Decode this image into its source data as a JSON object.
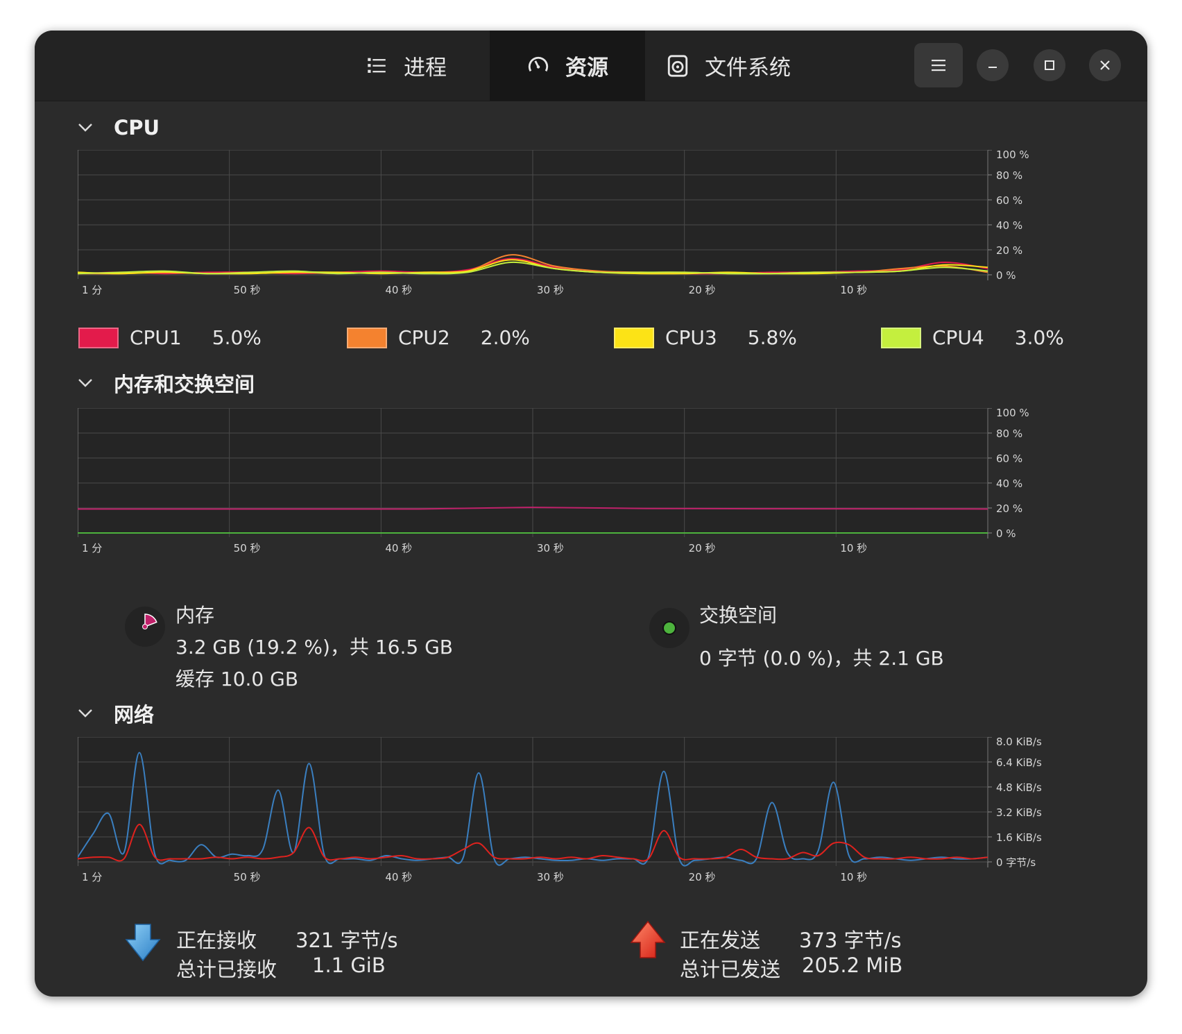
{
  "header": {
    "tabs": [
      {
        "label": "进程",
        "icon": "list-icon"
      },
      {
        "label": "资源",
        "icon": "gauge-icon",
        "active": true
      },
      {
        "label": "文件系统",
        "icon": "disk-icon"
      }
    ],
    "menu_icon": "hamburger-menu-icon",
    "window_controls": [
      "minimize-icon",
      "maximize-icon",
      "close-icon"
    ]
  },
  "time_axis": [
    "1 分",
    "50 秒",
    "40 秒",
    "30 秒",
    "20 秒",
    "10 秒"
  ],
  "cpu": {
    "title": "CPU",
    "y_ticks": [
      "100 %",
      "80 %",
      "60 %",
      "40 %",
      "20 %",
      "0 %"
    ],
    "legend": [
      {
        "name": "CPU1",
        "value": "5.0%",
        "color": "#e31b4b"
      },
      {
        "name": "CPU2",
        "value": "2.0%",
        "color": "#f4822f"
      },
      {
        "name": "CPU3",
        "value": "5.8%",
        "color": "#fce316"
      },
      {
        "name": "CPU4",
        "value": "3.0%",
        "color": "#c4ef3e"
      }
    ]
  },
  "memory": {
    "title": "内存和交换空间",
    "y_ticks": [
      "100 %",
      "80 %",
      "60 %",
      "40 %",
      "20 %",
      "0 %"
    ],
    "mem_label": "内存",
    "mem_usage": "3.2 GB (19.2 %)，共 16.5 GB",
    "mem_cache": "缓存 10.0 GB",
    "mem_fraction": 0.192,
    "swap_label": "交换空间",
    "swap_usage": "0 字节 (0.0 %)，共 2.1 GB",
    "colors": {
      "memory": "#c0216a",
      "swap": "#4db33d"
    }
  },
  "network": {
    "title": "网络",
    "y_ticks": [
      "8.0 KiB/s",
      "6.4 KiB/s",
      "4.8 KiB/s",
      "3.2 KiB/s",
      "1.6 KiB/s",
      "0 字节/s"
    ],
    "receiving_label": "正在接收",
    "receiving_value": "321 字节/s",
    "total_received_label": "总计已接收",
    "total_received_value": "1.1 GiB",
    "sending_label": "正在发送",
    "sending_value": "373 字节/s",
    "total_sent_label": "总计已发送",
    "total_sent_value": "205.2 MiB",
    "colors": {
      "receiving": "#3a7fc0",
      "sending": "#e0221e"
    }
  },
  "chart_data": [
    {
      "type": "line",
      "x": [
        60,
        57,
        54,
        51,
        48,
        45,
        42,
        39,
        36,
        33,
        30,
        27,
        24,
        21,
        18,
        15,
        12,
        9,
        6,
        3,
        0
      ],
      "ylim": [
        0,
        100
      ],
      "series": [
        {
          "name": "CPU1",
          "values": [
            1,
            2,
            1,
            2,
            2,
            1,
            2,
            3,
            2,
            4,
            13,
            6,
            2,
            2,
            1,
            1,
            2,
            2,
            3,
            4,
            10,
            5
          ]
        },
        {
          "name": "CPU2",
          "values": [
            1,
            1,
            2,
            1,
            2,
            2,
            1,
            2,
            1,
            3,
            16,
            7,
            3,
            2,
            2,
            1,
            1,
            2,
            2,
            5,
            7,
            2
          ]
        },
        {
          "name": "CPU3",
          "values": [
            2,
            1,
            2,
            1,
            1,
            2,
            2,
            1,
            2,
            3,
            12,
            5,
            2,
            1,
            1,
            2,
            1,
            1,
            2,
            3,
            8,
            6
          ]
        },
        {
          "name": "CPU4",
          "values": [
            1,
            2,
            3,
            1,
            2,
            3,
            1,
            2,
            1,
            2,
            10,
            5,
            2,
            2,
            2,
            1,
            1,
            2,
            2,
            3,
            6,
            3
          ]
        }
      ]
    },
    {
      "type": "line",
      "x": [
        60,
        45,
        40,
        35,
        32,
        28,
        20,
        10,
        0
      ],
      "ylim": [
        0,
        100
      ],
      "series": [
        {
          "name": "内存",
          "values": [
            19.2,
            19.2,
            19.2,
            19.2,
            20.5,
            19.6,
            19.4,
            19.3,
            19.2
          ]
        },
        {
          "name": "交换空间",
          "values": [
            0,
            0,
            0,
            0,
            0,
            0,
            0,
            0,
            0
          ]
        }
      ]
    },
    {
      "type": "line",
      "x": [
        60,
        58,
        57,
        56,
        55,
        54,
        53,
        52,
        51,
        50,
        49,
        48,
        47,
        46,
        45,
        44,
        43,
        42,
        41,
        40,
        39,
        38,
        37,
        36,
        35,
        34,
        33,
        32,
        31,
        30,
        29,
        28,
        27,
        26,
        25,
        24,
        23,
        22,
        21,
        20,
        19,
        18,
        17,
        16,
        15,
        14,
        13,
        12,
        11,
        10,
        9,
        8,
        7,
        6,
        5,
        4,
        3,
        2,
        1,
        0
      ],
      "ylim": [
        0,
        8.0
      ],
      "series": [
        {
          "name": "正在接收",
          "values": [
            0.3,
            1.8,
            3.1,
            0.6,
            7.0,
            0.5,
            0.1,
            0.1,
            1.1,
            0.3,
            0.5,
            0.4,
            0.8,
            4.6,
            0.6,
            6.3,
            0.4,
            0.2,
            0.2,
            0.1,
            0.4,
            0.2,
            0.1,
            0.2,
            0.3,
            0.3,
            5.7,
            0.2,
            0.2,
            0.3,
            0.2,
            0.1,
            0.1,
            0.2,
            0.1,
            0.2,
            0.2,
            0.3,
            5.8,
            0.2,
            0.1,
            0.2,
            0.3,
            0.1,
            0.2,
            3.8,
            0.6,
            0.2,
            0.7,
            5.1,
            0.4,
            0.2,
            0.3,
            0.2,
            0.1,
            0.2,
            0.3,
            0.2,
            0.2,
            0.3
          ]
        },
        {
          "name": "正在发送",
          "values": [
            0.2,
            0.3,
            0.3,
            0.2,
            2.4,
            0.3,
            0.2,
            0.2,
            0.2,
            0.3,
            0.2,
            0.3,
            0.2,
            0.3,
            0.6,
            2.2,
            0.3,
            0.2,
            0.3,
            0.2,
            0.3,
            0.4,
            0.2,
            0.2,
            0.3,
            0.8,
            1.2,
            0.3,
            0.2,
            0.2,
            0.3,
            0.2,
            0.3,
            0.2,
            0.4,
            0.3,
            0.2,
            0.2,
            2.0,
            0.3,
            0.2,
            0.2,
            0.3,
            0.8,
            0.3,
            0.2,
            0.2,
            0.6,
            0.4,
            1.2,
            1.1,
            0.3,
            0.2,
            0.2,
            0.3,
            0.2,
            0.2,
            0.3,
            0.2,
            0.3
          ]
        }
      ]
    }
  ]
}
